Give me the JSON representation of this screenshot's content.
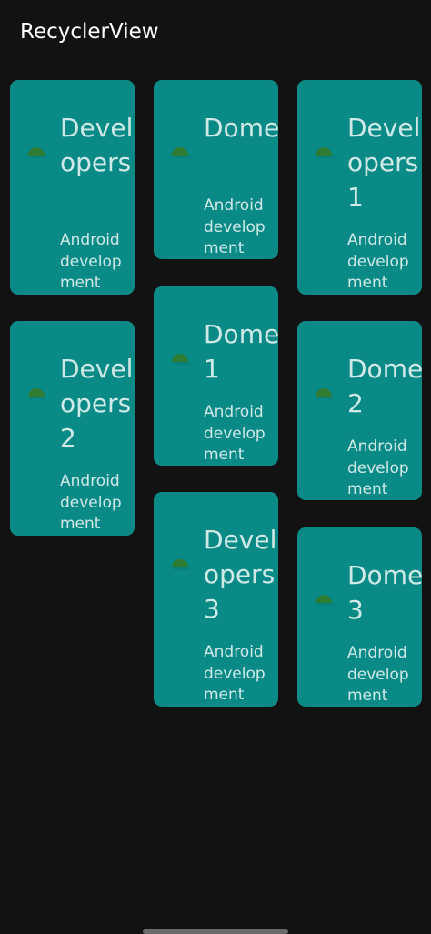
{
  "app_bar": {
    "title": "RecyclerView"
  },
  "cards": [
    {
      "title": "Developers",
      "subtitle": "Android development",
      "icon": "android-icon"
    },
    {
      "title": "Dome",
      "subtitle": "Android development",
      "icon": "android-icon"
    },
    {
      "title": "Developers1",
      "subtitle": "Android development",
      "icon": "android-icon"
    },
    {
      "title": "Developers2",
      "subtitle": "Android development",
      "icon": "android-icon"
    },
    {
      "title": "Dome1",
      "subtitle": "Android development",
      "icon": "android-icon"
    },
    {
      "title": "Dome2",
      "subtitle": "Android development",
      "icon": "android-icon"
    },
    {
      "title": "Developers3",
      "subtitle": "Android development",
      "icon": "android-icon"
    },
    {
      "title": "Dome3",
      "subtitle": "Android development",
      "icon": "android-icon"
    }
  ],
  "colors": {
    "background": "#121212",
    "card": "#0a8a86",
    "card_text": "#cfe9e7",
    "icon": "#2e7d32"
  }
}
